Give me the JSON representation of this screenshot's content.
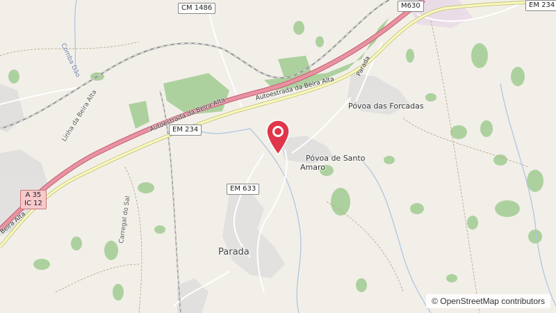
{
  "map": {
    "places": {
      "povoa_forcadas": "Póvoa das Forcadas",
      "povoa_santo_amaro_1": "Póvoa de Santo",
      "povoa_santo_amaro_2": "Amaro",
      "parada": "Parada"
    },
    "road_shields": {
      "cm1486": "CM 1486",
      "m630": "M630",
      "em234_right": "EM 234",
      "em234_left": "EM 234",
      "em633": "EM 633",
      "a35": "A 35",
      "ic12": "IC 12"
    },
    "road_labels": {
      "autoestrada_1": "Autoestrada da Beira Alta",
      "autoestrada_2": "Autoestrada da Beira Alta",
      "autoestrada_3": "Beira Alta",
      "parada_street": "Parada"
    },
    "rail_labels": {
      "linha_beira_alta": "Linha da Beira Alta",
      "carregal": "Carregal do Sal",
      "combadao": "Comba Dão"
    },
    "attribution": "© OpenStreetMap contributors"
  },
  "colors": {
    "background": "#f2efe9",
    "forest": "#add19e",
    "motorway": "#e892a2",
    "primary_road": "#f7fabf",
    "residential": "#e0dfdf",
    "marker": "#e0354b"
  }
}
